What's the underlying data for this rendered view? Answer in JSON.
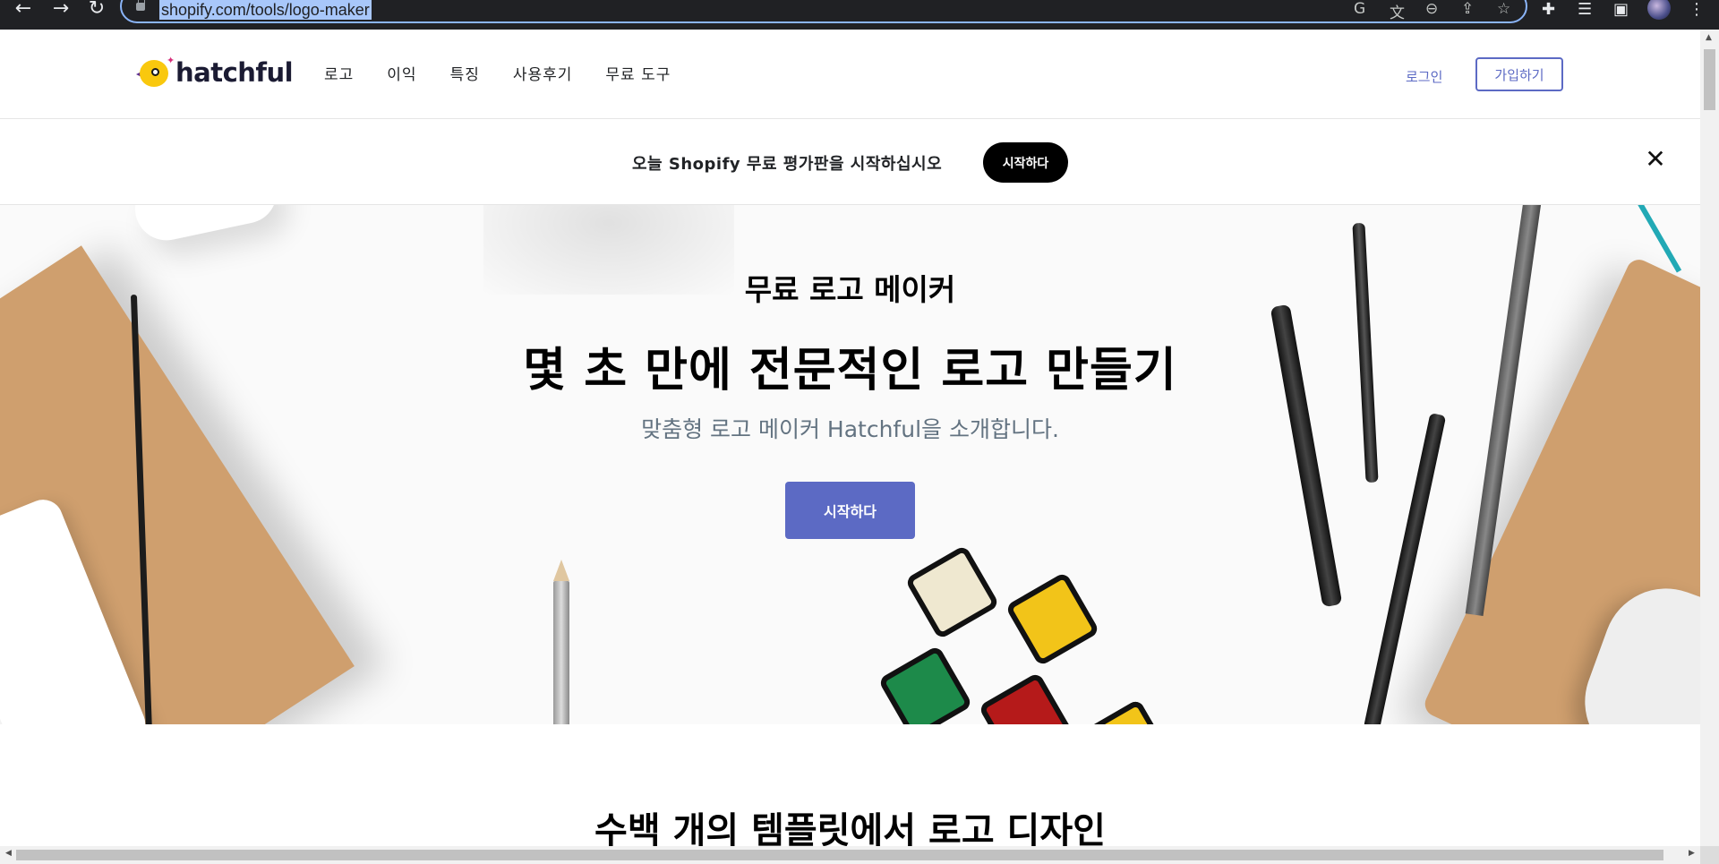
{
  "browser": {
    "url": "shopify.com/tools/logo-maker",
    "back_icon": "←",
    "forward_icon": "→",
    "reload_icon": "↻",
    "menu_icon": "⋮"
  },
  "header": {
    "logo_text": "hatchful",
    "nav": [
      "로고",
      "이익",
      "특징",
      "사용후기",
      "무료 도구"
    ],
    "login_label": "로그인",
    "signup_label": "가입하기"
  },
  "promo": {
    "text": "오늘 Shopify 무료 평가판을 시작하십시오",
    "button_label": "시작하다",
    "close_icon": "✕"
  },
  "hero": {
    "eyebrow": "무료 로고 메이커",
    "title": "몇 초 만에 전문적인 로고 만들기",
    "subtitle": "맞춤형 로고 메이커 Hatchful을 소개합니다.",
    "button_label": "시작하다"
  },
  "section": {
    "title": "수백 개의 템플릿에서 로고 디자인"
  },
  "colors": {
    "accent": "#5c6ac4",
    "brand_yellow": "#f9c80e",
    "subtitle_gray": "#637381"
  }
}
